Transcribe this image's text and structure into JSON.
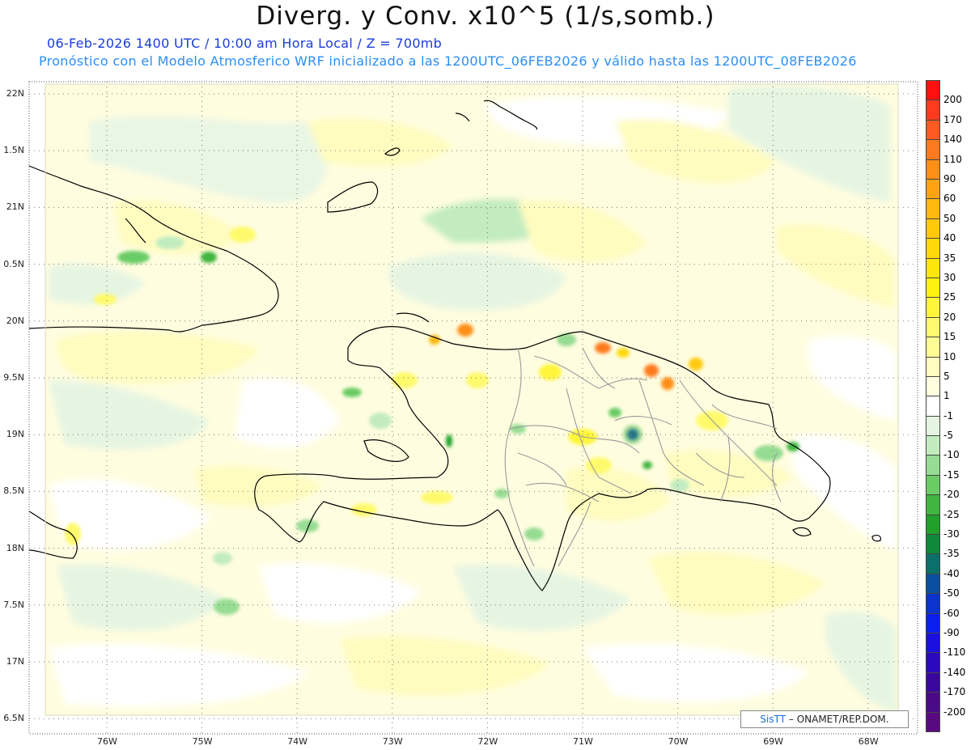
{
  "title": "Diverg. y Conv. x10^5 (1/s,somb.)",
  "subtitle_time": "06-Feb-2026  1400 UTC / 10:00 am Hora Local / Z = 700mb",
  "subtitle_model": "Pronóstico con el Modelo Atmosferico WRF inicializado a las 1200UTC_06FEB2026 y válido hasta las  1200UTC_08FEB2026",
  "credit": {
    "brand": "SisTT",
    "text": " – ONAMET/REP.DOM."
  },
  "map": {
    "lat_labels": [
      "22N",
      "1.5N",
      "21N",
      "0.5N",
      "20N",
      "9.5N",
      "19N",
      "8.5N",
      "18N",
      "7.5N",
      "17N",
      "6.5N"
    ],
    "lon_labels": [
      "76W",
      "75W",
      "74W",
      "73W",
      "72W",
      "71W",
      "70W",
      "69W",
      "68W"
    ]
  },
  "colorbar": {
    "levels": [
      {
        "label": "200",
        "color": "#ff1010"
      },
      {
        "label": "170",
        "color": "#ff3a1e"
      },
      {
        "label": "140",
        "color": "#ff5a22"
      },
      {
        "label": "110",
        "color": "#ff7a1c"
      },
      {
        "label": "90",
        "color": "#ff8e14"
      },
      {
        "label": "60",
        "color": "#ffa410"
      },
      {
        "label": "50",
        "color": "#ffb80c"
      },
      {
        "label": "40",
        "color": "#ffc90a"
      },
      {
        "label": "35",
        "color": "#ffd80a"
      },
      {
        "label": "30",
        "color": "#ffe60a"
      },
      {
        "label": "25",
        "color": "#fff00e"
      },
      {
        "label": "20",
        "color": "#fff63a"
      },
      {
        "label": "15",
        "color": "#fffa6c"
      },
      {
        "label": "10",
        "color": "#fffb94"
      },
      {
        "label": "5",
        "color": "#fffcc0"
      },
      {
        "label": "1",
        "color": "#ffffe0"
      },
      {
        "label": "-1",
        "color": "#ffffff"
      },
      {
        "label": "-5",
        "color": "#e6f5e2"
      },
      {
        "label": "-10",
        "color": "#c2ecc0"
      },
      {
        "label": "-15",
        "color": "#96dc93"
      },
      {
        "label": "-20",
        "color": "#6bcc66"
      },
      {
        "label": "-25",
        "color": "#40b540"
      },
      {
        "label": "-30",
        "color": "#1fa12a"
      },
      {
        "label": "-35",
        "color": "#0f8a3a"
      },
      {
        "label": "-40",
        "color": "#0b6f6a"
      },
      {
        "label": "-50",
        "color": "#0a4fa0"
      },
      {
        "label": "-60",
        "color": "#0a33d0"
      },
      {
        "label": "-90",
        "color": "#0a1ef0"
      },
      {
        "label": "-110",
        "color": "#1a10e0"
      },
      {
        "label": "-140",
        "color": "#2a08c0"
      },
      {
        "label": "-170",
        "color": "#3a08a0"
      },
      {
        "label": "-200",
        "color": "#4a0a88"
      },
      {
        "label": "",
        "color": "#5a0a80"
      }
    ]
  },
  "colors": {
    "coast": "#000000",
    "borders": "#999999",
    "grid": "#666666"
  }
}
